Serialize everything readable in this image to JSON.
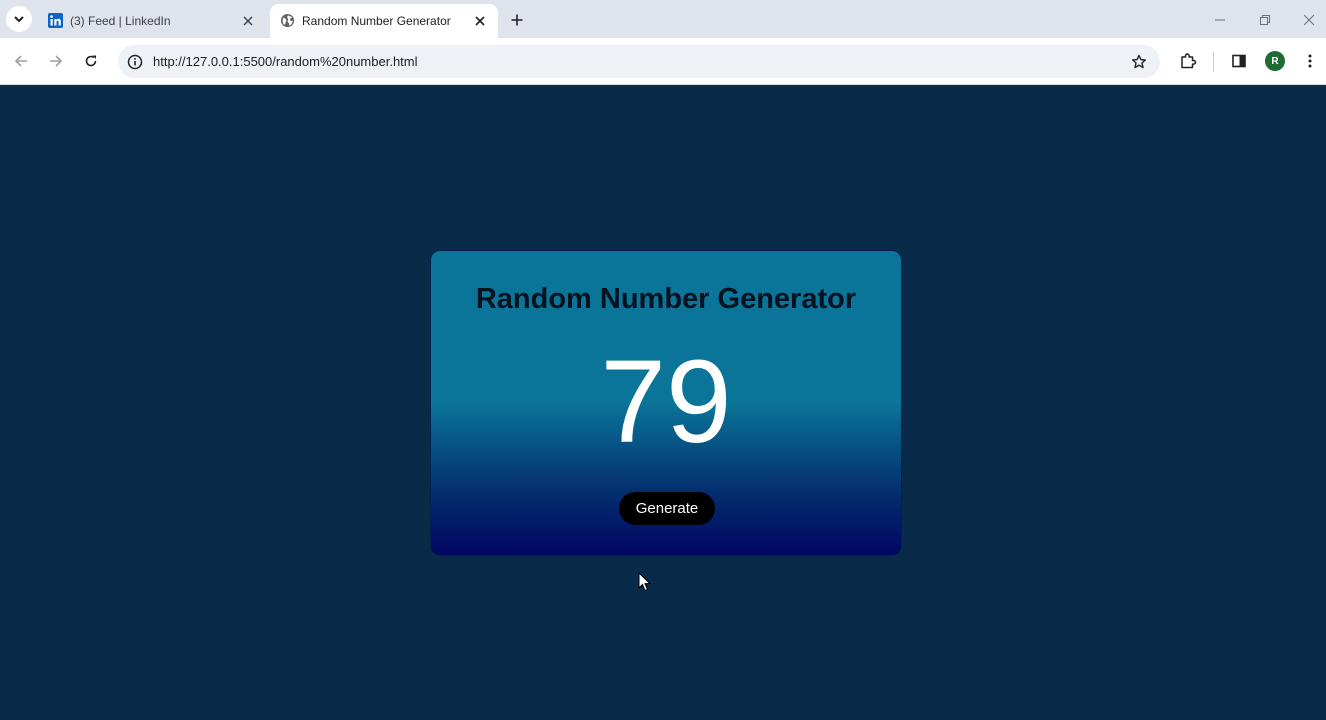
{
  "browser": {
    "tabs": [
      {
        "title": "(3) Feed | LinkedIn",
        "icon": "linkedin-icon",
        "active": false
      },
      {
        "title": "Random Number Generator",
        "icon": "globe-icon",
        "active": true
      }
    ],
    "url": "http://127.0.0.1:5500/random%20number.html",
    "profile_initial": "R",
    "colors": {
      "linkedin": "#0a66c2",
      "profile": "#1e6b34"
    }
  },
  "page": {
    "title": "Random Number Generator",
    "number": "79",
    "button_label": "Generate",
    "colors": {
      "background": "#0a2a4a",
      "card_top": "#0a7499",
      "card_bottom": "#010663",
      "button": "#000000"
    }
  }
}
